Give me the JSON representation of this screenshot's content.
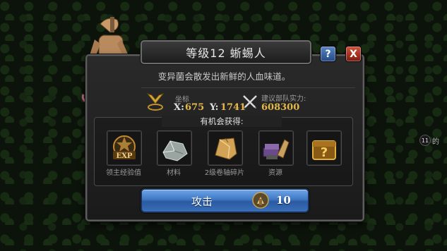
{
  "dialog": {
    "title": "等级12 蜥蜴人",
    "description": "变异菌会散发出新鲜的人血味道。",
    "help_label": "?",
    "close_label": "X"
  },
  "location": {
    "label": "坐标",
    "x_label": "X:",
    "x_value": "675",
    "y_label": "Y:",
    "y_value": "1741"
  },
  "power": {
    "label": "建议部队实力:",
    "value": "608300"
  },
  "rewards": {
    "title": "有机会获得:",
    "items": [
      {
        "label": "领主经验值",
        "icon": "exp-icon"
      },
      {
        "label": "材料",
        "icon": "material-icon"
      },
      {
        "label": "2级卷轴碎片",
        "icon": "scroll-fragment-icon"
      },
      {
        "label": "资源",
        "icon": "resource-icon"
      },
      {
        "label": "",
        "icon": "mystery-chest-icon"
      }
    ]
  },
  "attack": {
    "label": "攻击",
    "cost": "10"
  },
  "map_marker": {
    "number": "11",
    "text": "的"
  },
  "colors": {
    "accent_gold": "#e5b84b",
    "button_blue": "#3f77c2",
    "close_red": "#c0392b",
    "help_blue": "#3a6fb0"
  }
}
